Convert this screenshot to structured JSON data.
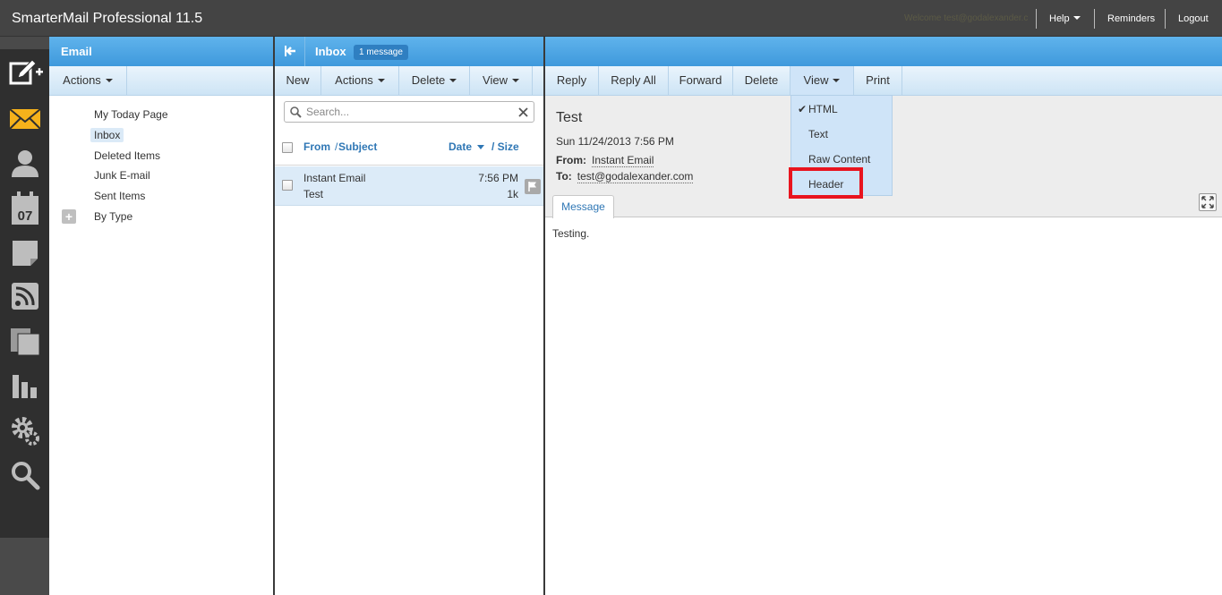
{
  "app": {
    "title": "SmarterMail Professional 11.5",
    "top_faint_text": "Welcome test@godalexander.com",
    "help_label": "Help",
    "reminders_label": "Reminders",
    "logout_label": "Logout"
  },
  "rail": {
    "icons": [
      "compose-icon",
      "mail-icon",
      "contacts-icon",
      "calendar-icon",
      "notes-icon",
      "rss-icon",
      "files-icon",
      "reports-icon",
      "settings-icon",
      "search-icon"
    ],
    "calendar_day": "07"
  },
  "folder_panel": {
    "title": "Email",
    "actions_label": "Actions",
    "items": [
      {
        "label": "My Today Page"
      },
      {
        "label": "Inbox"
      },
      {
        "label": "Deleted Items"
      },
      {
        "label": "Junk E-mail"
      },
      {
        "label": "Sent Items"
      },
      {
        "label": "By Type"
      }
    ]
  },
  "list_panel": {
    "title": "Inbox",
    "badge": "1 message",
    "toolbar": {
      "new": "New",
      "actions": "Actions",
      "delete": "Delete",
      "view": "View"
    },
    "search_placeholder": "Search...",
    "sort": {
      "from": "From",
      "separator": "/",
      "subject": "Subject",
      "date": "Date",
      "size": "/ Size"
    },
    "messages": [
      {
        "from": "Instant Email",
        "subject": "Test",
        "time": "7:56 PM",
        "size": "1k"
      }
    ]
  },
  "read_pane": {
    "toolbar": {
      "reply": "Reply",
      "reply_all": "Reply All",
      "forward": "Forward",
      "delete": "Delete",
      "view": "View",
      "print": "Print"
    },
    "subject": "Test",
    "date": "Sun 11/24/2013 7:56 PM",
    "from_label": "From:",
    "from_value": "Instant Email",
    "to_label": "To:",
    "to_value": "test@godalexander.com",
    "tab_label": "Message",
    "body": "Testing."
  },
  "view_menu": {
    "check": "✔",
    "items": [
      {
        "label": "HTML"
      },
      {
        "label": "Text"
      },
      {
        "label": "Raw Content"
      },
      {
        "label": "Header"
      }
    ],
    "highlight_color": "#e8141f"
  }
}
